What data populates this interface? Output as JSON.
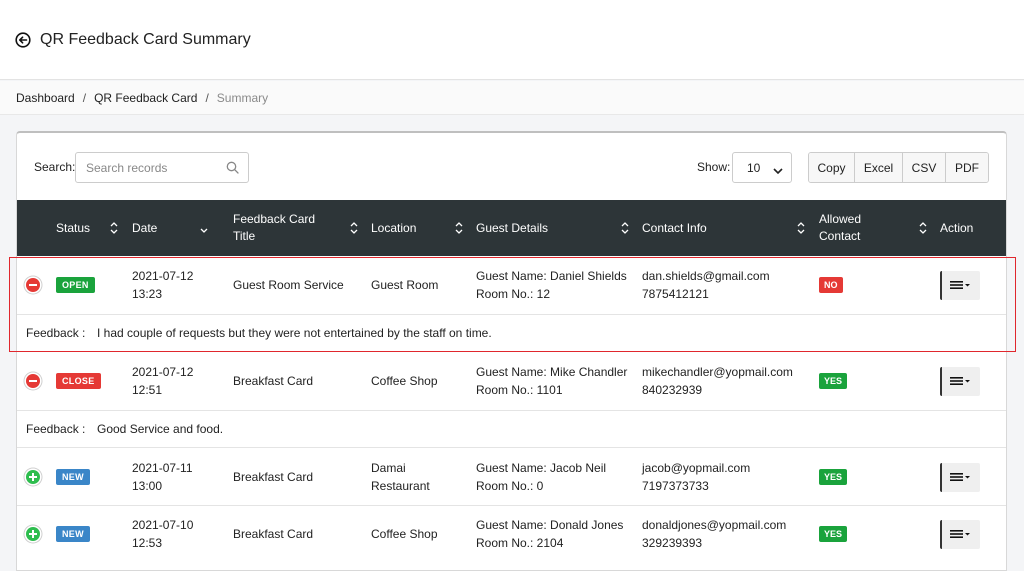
{
  "header": {
    "title": "QR Feedback Card Summary"
  },
  "breadcrumb": {
    "items": [
      "Dashboard",
      "QR Feedback Card"
    ],
    "current": "Summary",
    "separator": "/"
  },
  "toolbar": {
    "search_label": "Search:",
    "search_placeholder": "Search records",
    "search_value": "",
    "show_label": "Show:",
    "show_value": "10",
    "export_buttons": [
      "Copy",
      "Excel",
      "CSV",
      "PDF"
    ]
  },
  "table": {
    "columns": [
      "Status",
      "Date",
      "Feedback Card Title",
      "Location",
      "Guest Details",
      "Contact Info",
      "Allowed Contact",
      "Action"
    ],
    "feedback_label": "Feedback :",
    "rows": [
      {
        "expanded": true,
        "status": "OPEN",
        "date": "2021-07-12",
        "time": "13:23",
        "title": "Guest Room Service",
        "location": "Guest Room",
        "guest_name": "Guest Name: Daniel Shields",
        "room_no": "Room No.: 12",
        "email": "dan.shields@gmail.com",
        "phone": "7875412121",
        "allowed": "NO",
        "feedback": "I had couple of requests but they were not entertained by the staff on time."
      },
      {
        "expanded": true,
        "status": "CLOSE",
        "date": "2021-07-12",
        "time": "12:51",
        "title": "Breakfast Card",
        "location": "Coffee Shop",
        "guest_name": "Guest Name: Mike Chandler",
        "room_no": "Room No.: 1101",
        "email": "mikechandler@yopmail.com",
        "phone": "840232939",
        "allowed": "YES",
        "feedback": "Good Service and food."
      },
      {
        "expanded": false,
        "status": "NEW",
        "date": "2021-07-11",
        "time": "13:00",
        "title": "Breakfast Card",
        "location": "Damai Restaurant",
        "guest_name": "Guest Name: Jacob Neil",
        "room_no": "Room No.: 0",
        "email": "jacob@yopmail.com",
        "phone": "7197373733",
        "allowed": "YES",
        "feedback": ""
      },
      {
        "expanded": false,
        "status": "NEW",
        "date": "2021-07-10",
        "time": "12:53",
        "title": "Breakfast Card",
        "location": "Coffee Shop",
        "guest_name": "Guest Name: Donald Jones",
        "room_no": "Room No.: 2104",
        "email": "donaldjones@yopmail.com",
        "phone": "329239393",
        "allowed": "YES",
        "feedback": ""
      }
    ]
  },
  "colors": {
    "open": "#1aa33c",
    "close": "#e53935",
    "new": "#3a86c8",
    "header_bg": "#2d3538",
    "highlight": "#e0272d"
  }
}
